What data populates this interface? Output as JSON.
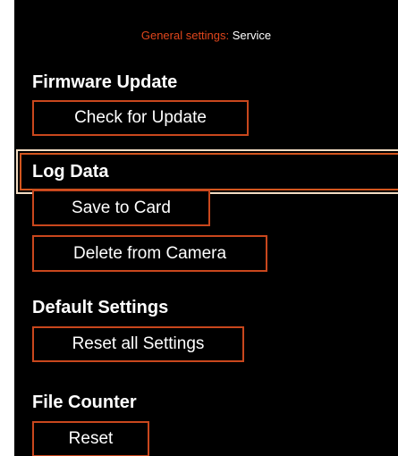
{
  "header": {
    "crumb": "General settings:",
    "page": "Service"
  },
  "sections": {
    "firmware": {
      "title": "Firmware Update",
      "button": "Check for Update"
    },
    "log": {
      "title": "Log Data",
      "save_button": "Save to Card",
      "delete_button": "Delete from Camera"
    },
    "defaults": {
      "title": "Default Settings",
      "button": "Reset all Settings"
    },
    "counter": {
      "title": "File Counter",
      "button": "Reset"
    }
  },
  "colors": {
    "background": "#000000",
    "accent": "#e0461c",
    "button_border": "#c9471d",
    "selection_outer": "#f1dcc2",
    "text": "#ffffff"
  }
}
